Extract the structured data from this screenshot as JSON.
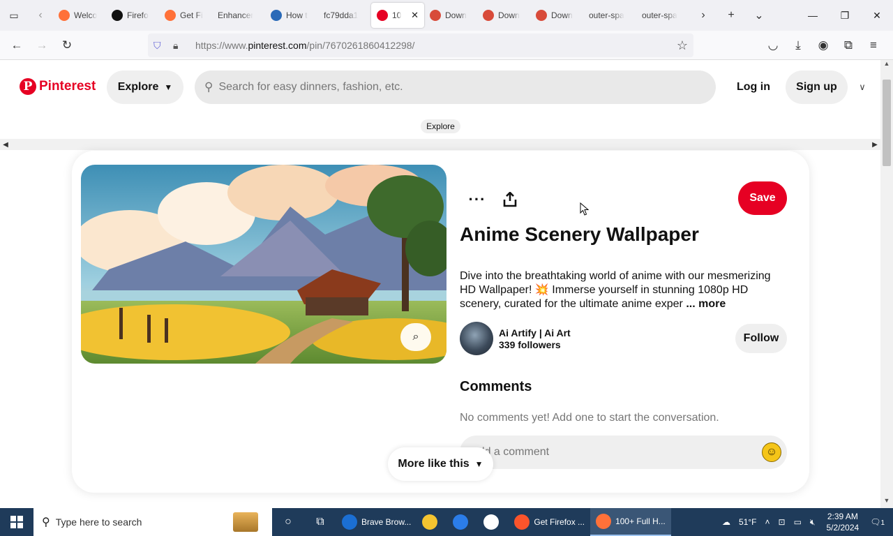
{
  "browser": {
    "tabs": [
      {
        "label": "Welco",
        "icon": "firefox-icon",
        "color": "#ff7139"
      },
      {
        "label": "Firefo",
        "icon": "m-logo-icon",
        "color": "#111111"
      },
      {
        "label": "Get Fi",
        "icon": "firefox-icon",
        "color": "#ff7139"
      },
      {
        "label": "Enhancer",
        "icon": "",
        "color": ""
      },
      {
        "label": "How t",
        "icon": "monitor-icon",
        "color": "#2a6ab8"
      },
      {
        "label": "fc79dda1",
        "icon": "",
        "color": ""
      },
      {
        "label": "10",
        "icon": "pinterest-icon",
        "color": "#e60023",
        "active": true
      },
      {
        "label": "Down",
        "icon": "colorwheel-icon",
        "color": "#d84b3a"
      },
      {
        "label": "Down",
        "icon": "colorwheel-icon",
        "color": "#d84b3a"
      },
      {
        "label": "Down",
        "icon": "colorwheel-icon",
        "color": "#d84b3a"
      },
      {
        "label": "outer-spa",
        "icon": "",
        "color": ""
      },
      {
        "label": "outer-spa",
        "icon": "",
        "color": ""
      }
    ],
    "url_prefix": "https://www.",
    "url_domain": "pinterest.com",
    "url_path": "/pin/7670261860412298/"
  },
  "header": {
    "logo_text": "Pinterest",
    "explore_label": "Explore",
    "search_placeholder": "Search for easy dinners, fashion, etc.",
    "login_label": "Log in",
    "signup_label": "Sign up"
  },
  "breadcrumb": "Explore",
  "pin": {
    "save_label": "Save",
    "title": "Anime Scenery Wallpaper",
    "description": "Dive into the breathtaking world of anime with our mesmerizing HD Wallpaper! 💥 Immerse yourself in stunning 1080p HD scenery, curated for the ultimate anime exper",
    "more_label": "... more",
    "author_name": "Ai Artify | Ai Art",
    "author_followers": "339 followers",
    "follow_label": "Follow",
    "comments_heading": "Comments",
    "no_comments_text": "No comments yet! Add one to start the conversation.",
    "comment_placeholder": "Add a comment",
    "more_like_this": "More like this"
  },
  "taskbar": {
    "search_placeholder": "Type here to search",
    "apps": [
      {
        "label": "Brave Brow...",
        "color": "#1b6fd3"
      },
      {
        "label": "",
        "color": "#f4c430"
      },
      {
        "label": "",
        "color": "#2b7de9"
      },
      {
        "label": "",
        "color": "#ffffff"
      },
      {
        "label": "Get Firefox ...",
        "color": "#fb542b"
      },
      {
        "label": "100+ Full H...",
        "color": "#ff7139",
        "active": true
      }
    ],
    "weather": "51°F",
    "time": "2:39 AM",
    "date": "5/2/2024",
    "notifications": "1"
  },
  "colors": {
    "brand": "#e60023",
    "taskbar": "#1f3b5a"
  }
}
